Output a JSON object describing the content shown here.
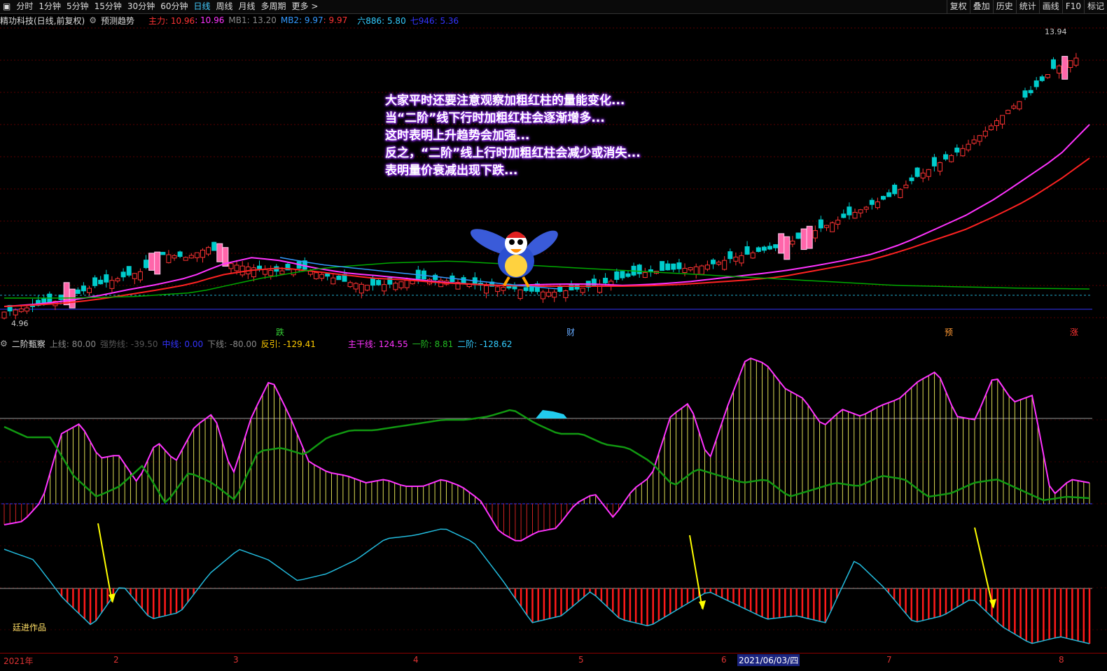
{
  "toolbar": {
    "left": [
      "分时",
      "1分钟",
      "5分钟",
      "15分钟",
      "30分钟",
      "60分钟",
      "日线",
      "周线",
      "月线",
      "多周期",
      "更多 >"
    ],
    "active": "日线",
    "right": [
      "复权",
      "叠加",
      "历史",
      "统计",
      "画线",
      "F10",
      "标记"
    ]
  },
  "main_info": {
    "stock": "精功科技(日线,前复权)",
    "predict": "预测趋势",
    "zhuli_label": "主力: 10.96",
    "zhuli_val": ": 10.96",
    "mb1": "MB1: 13.20",
    "mb2_label": "MB2: 9.97",
    "mb2_val": ": 9.97",
    "liu": "六886: 5.80",
    "qi": "七946: 5.36"
  },
  "price_labels": {
    "high": "13.94",
    "low": "4.96"
  },
  "annotation": [
    "大家平时还要注意观察加粗红柱的量能变化...",
    "当“二阶”线下行时加粗红柱会逐渐增多...",
    "这时表明上升趋势会加强...",
    "反之，“二阶”线上行时加粗红柱会减少或消失...",
    "表明量价衰减出现下跌..."
  ],
  "signals": [
    {
      "text": "跌",
      "color": "#33cc33"
    },
    {
      "text": "财",
      "color": "#66aaff"
    },
    {
      "text": "预",
      "color": "#ff9933"
    },
    {
      "text": "涨",
      "color": "#ff3333"
    }
  ],
  "indicator_info": {
    "name": "二阶甄察",
    "upper": "上线: 80.00",
    "strong": "强势线: -39.50",
    "mid": "中线: 0.00",
    "lower": "下线: -80.00",
    "fanyin": "反引: -129.41",
    "main": "主干线: 124.55",
    "yijie": "一阶: 8.81",
    "erjie": "二阶: -128.62"
  },
  "credit": "廷进作品",
  "xaxis": {
    "labels": [
      "2021年",
      "2",
      "3",
      "4",
      "5",
      "6",
      "7",
      "8"
    ],
    "selected": "2021/06/03/四"
  },
  "colors": {
    "up": "#ff3333",
    "down": "#00cccc",
    "ma1": "#ff33ff",
    "ma2": "#ff2222",
    "ma3": "#00aa00",
    "ma4": "#3399ff",
    "main": "#ff33ff",
    "yijie": "#22aa22"
  }
}
